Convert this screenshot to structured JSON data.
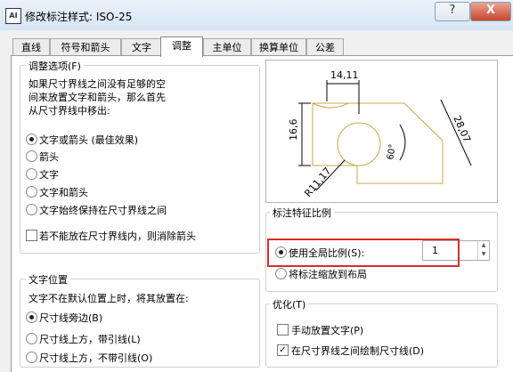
{
  "window": {
    "title": "修改标注样式: ISO-25",
    "app_icon": "AI",
    "help_label": "?",
    "close_label": "X"
  },
  "tabs": [
    "直线",
    "符号和箭头",
    "文字",
    "调整",
    "主单位",
    "换算单位",
    "公差"
  ],
  "fit_options": {
    "title": "调整选项(F)",
    "description": [
      "如果尺寸界线之间没有足够的空",
      "间来放置文字和箭头，那么首先",
      "从尺寸界线中移出:"
    ],
    "options": [
      "文字或箭头 (最佳效果)",
      "箭头",
      "文字",
      "文字和箭头",
      "文字始终保持在尺寸界线之间"
    ],
    "selected_index": 0,
    "suppress_label": "若不能放在尺寸界线内，则消除箭头",
    "suppress_checked": false
  },
  "text_placement": {
    "title": "文字位置",
    "description": "文字不在默认位置上时，将其放置在:",
    "options": [
      "尺寸线旁边(B)",
      "尺寸线上方，带引线(L)",
      "尺寸线上方，不带引线(O)"
    ],
    "selected_index": 0
  },
  "preview": {
    "dim_top": "14,11",
    "dim_left": "16,6",
    "dim_right": "28,07",
    "dim_angle": "60°",
    "dim_radius": "R11,17"
  },
  "scale": {
    "title": "标注特征比例",
    "use_overall_label": "使用全局比例(S):",
    "use_overall_selected": true,
    "scale_value": "1",
    "layout_label": "将标注缩放到布局"
  },
  "fine_tuning": {
    "title": "优化(T)",
    "manual_label": "手动放置文字(P)",
    "manual_checked": false,
    "draw_line_label": "在尺寸界线之间绘制尺寸线(D)",
    "draw_line_checked": true
  },
  "colors": {
    "highlight": "#d62d2d",
    "preview_shape": "#c8a848"
  }
}
